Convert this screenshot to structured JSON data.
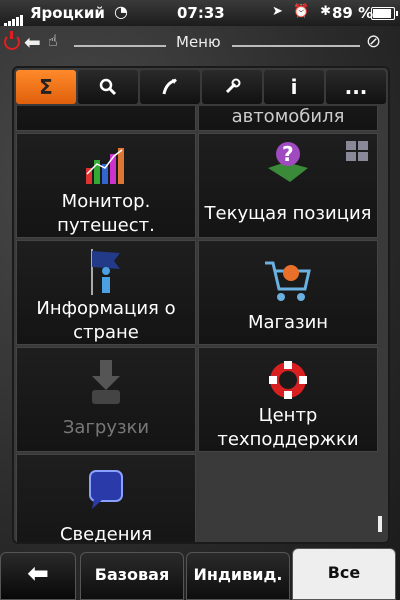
{
  "status": {
    "carrier": "Яроцкий",
    "time": "07:33",
    "battery": "89 %",
    "battery_level": 0.89,
    "icons": "➤ ⏰ ✱"
  },
  "titlebar": {
    "title": "Меню",
    "back_glyph": "⬅",
    "hand_glyph": "☝",
    "gps_glyph": "⊘"
  },
  "tabs": [
    {
      "label": "Σ",
      "icon": "sigma-icon",
      "active": true
    },
    {
      "label": "🔍",
      "icon": "search-icon"
    },
    {
      "label": "↷",
      "icon": "route-icon"
    },
    {
      "label": "🔧",
      "icon": "wrench-icon"
    },
    {
      "label": "i",
      "icon": "info-icon"
    },
    {
      "label": "...",
      "icon": "more-icon"
    }
  ],
  "grid": {
    "top_partial_label": "автомобиля",
    "items": [
      {
        "label1": "Монитор.",
        "label2": "путешест.",
        "icon": "bar-chart-icon"
      },
      {
        "label1": "Текущая позиция",
        "label2": "",
        "icon": "map-question-icon"
      },
      {
        "label1": "Информация о",
        "label2": "стране",
        "icon": "info-flag-icon"
      },
      {
        "label1": "Магазин",
        "label2": "",
        "icon": "shopping-cart-icon"
      },
      {
        "label1": "Загрузки",
        "label2": "",
        "icon": "download-icon",
        "disabled": true
      },
      {
        "label1": "Центр",
        "label2": "техподдержки",
        "icon": "lifebuoy-icon"
      },
      {
        "label1": "Сведения",
        "label2": "",
        "icon": "speech-bubble-icon"
      }
    ]
  },
  "bottom": {
    "back_glyph": "⬅",
    "tabs": [
      {
        "label": "Базовая"
      },
      {
        "label": "Индивид."
      },
      {
        "label": "Все",
        "active": true
      }
    ]
  },
  "colors": {
    "accent": "#f07a1c",
    "power": "#e02020"
  }
}
